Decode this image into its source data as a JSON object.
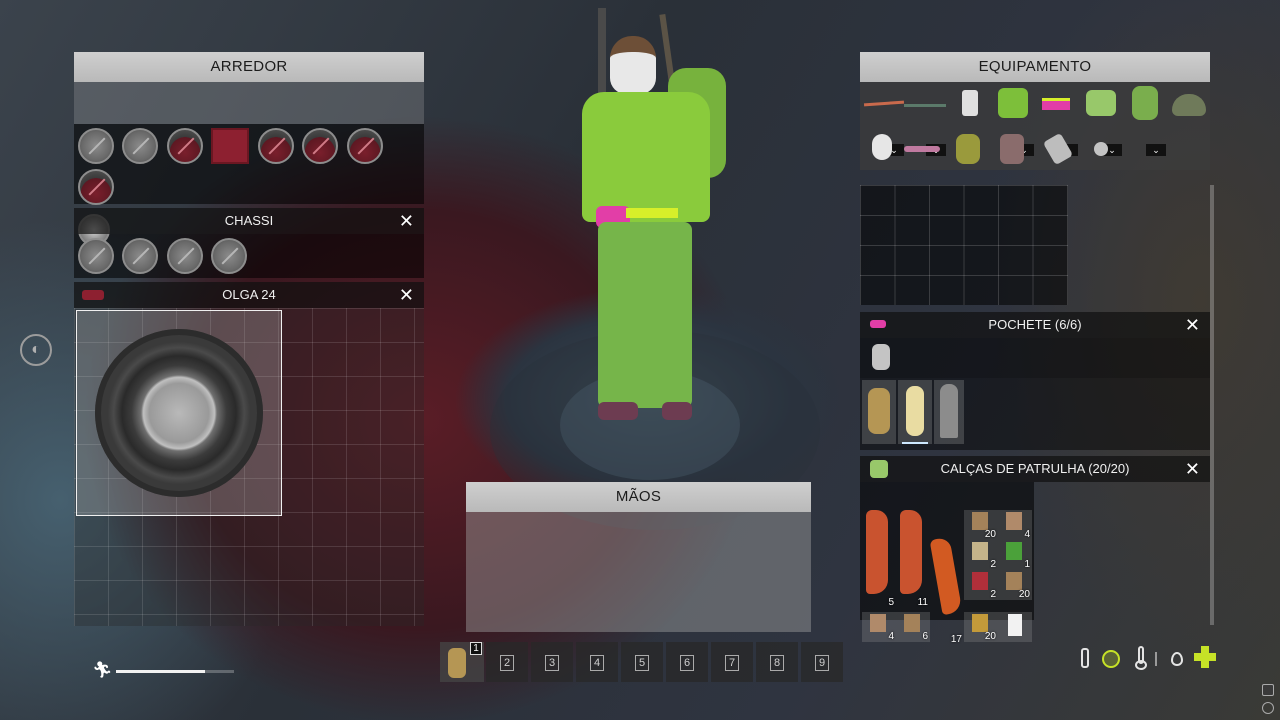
{
  "vicinity": {
    "title": "ARREDOR"
  },
  "chassis": {
    "title": "CHASSI",
    "close": "✕"
  },
  "vehicle": {
    "title": "OLGA 24",
    "close": "✕"
  },
  "hands": {
    "title": "MÃOS"
  },
  "equipment": {
    "title": "EQUIPAMENTO",
    "chevron": "⌄"
  },
  "fanny_pack": {
    "title": "POCHETE (6/6)",
    "close": "✕"
  },
  "pants": {
    "title": "CALÇAS DE PATRULHA (20/20)",
    "close": "✕",
    "quantities": [
      "20",
      "4",
      "2",
      "1",
      "5",
      "11",
      "2",
      "20",
      "4",
      "6",
      "17",
      "20"
    ]
  },
  "hotbar": {
    "slots": [
      "1",
      "2",
      "3",
      "4",
      "5",
      "6",
      "7",
      "8",
      "9"
    ]
  },
  "stamina": {
    "level": 0.75
  },
  "colors": {
    "header_bg": "#c4c4c4",
    "accent_green": "#c6e227",
    "hazard_red": "#8d2030"
  }
}
